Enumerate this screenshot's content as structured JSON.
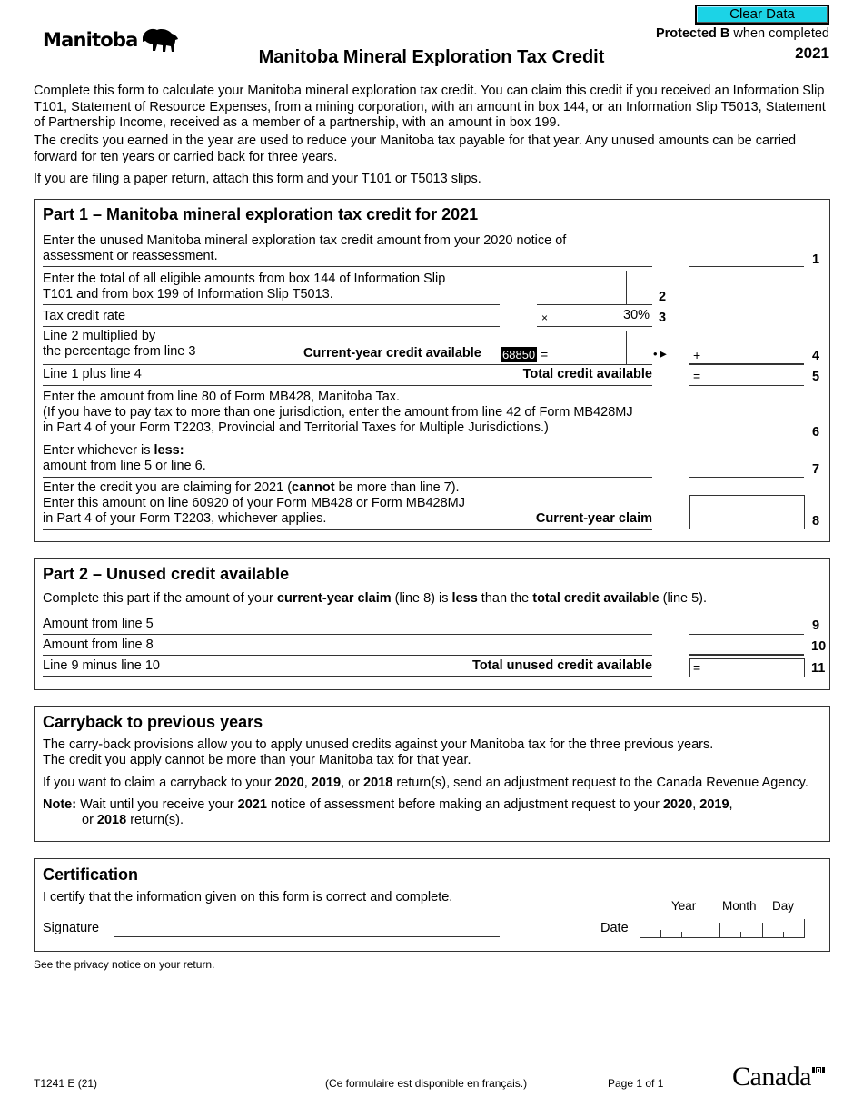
{
  "header": {
    "logo_text": "Manitoba",
    "clear_button": "Clear Data",
    "protected_bold": "Protected B",
    "protected_rest": " when completed",
    "year": "2021",
    "title": "Manitoba Mineral Exploration Tax Credit"
  },
  "intro": {
    "p1": "Complete this form to calculate your Manitoba mineral exploration tax credit. You can claim this credit if you received an Information Slip T101, Statement of Resource Expenses, from a mining corporation, with an amount in box 144, or an Information Slip T5013, Statement of Partnership Income, received as a member of a partnership, with an amount in box 199.",
    "p2": "The credits you earned in the year are used to reduce your Manitoba tax payable for that year. Any unused amounts can be carried forward for ten years or carried back for three years.",
    "p3": "If you are filing a paper return, attach this form and your T101 or T5013 slips."
  },
  "part1": {
    "title": "Part 1 – Manitoba mineral exploration tax credit for 2021",
    "line1_text": "Enter the unused Manitoba mineral exploration tax credit amount from your 2020 notice of assessment or reassessment.",
    "line1_num": "1",
    "line2_text": "Enter the total of all eligible amounts from box 144 of Information Slip T101 and from box 199 of Information Slip T5013.",
    "line2_num": "2",
    "line3_text": "Tax credit rate",
    "line3_symbol": "×",
    "line3_rate": "30%",
    "line3_num": "3",
    "line4_text_a": "Line 2 multiplied by",
    "line4_text_b": "the percentage from line 3",
    "line4_label": "Current-year credit available",
    "line4_code": "68850",
    "line4_eq": "=",
    "line4_arrow": "•►",
    "line4_symbol": "+",
    "line4_num": "4",
    "line5_text": "Line 1 plus line 4",
    "line5_label": "Total credit available",
    "line5_symbol": "=",
    "line5_num": "5",
    "line6_text_a": "Enter the amount from line 80 of Form MB428, Manitoba Tax.",
    "line6_text_b": "(If you have to pay tax to more than one jurisdiction, enter the amount from line 42 of Form MB428MJ",
    "line6_text_c": "in Part 4 of your Form T2203, Provincial and Territorial Taxes for Multiple Jurisdictions.)",
    "line6_num": "6",
    "line7_text_a_pre": "Enter whichever is ",
    "line7_text_a_bold": "less:",
    "line7_text_b": "amount from line 5 or line 6.",
    "line7_num": "7",
    "line8_text_a_pre": "Enter the credit you are claiming for 2021 (",
    "line8_text_a_bold": "cannot",
    "line8_text_a_post": " be more than line 7).",
    "line8_text_b": "Enter this amount on line 60920 of your Form MB428 or Form MB428MJ",
    "line8_text_c": "in Part 4 of your Form T2203, whichever applies.",
    "line8_label": "Current-year claim",
    "line8_num": "8"
  },
  "part2": {
    "title": "Part 2 – Unused credit available",
    "intro_a": "Complete this part if the amount of your ",
    "intro_b": "current-year claim",
    "intro_c": " (line 8) is ",
    "intro_d": "less",
    "intro_e": " than the ",
    "intro_f": "total credit available",
    "intro_g": " (line 5).",
    "line9_text": "Amount from line 5",
    "line9_num": "9",
    "line10_text": "Amount from line 8",
    "line10_symbol": "–",
    "line10_num": "10",
    "line11_text": "Line 9 minus line 10",
    "line11_label": "Total unused credit available",
    "line11_symbol": "=",
    "line11_num": "11"
  },
  "carryback": {
    "title": "Carryback to previous years",
    "p1a": "The carry-back provisions allow you to apply unused credits against your Manitoba tax for the three previous years.",
    "p1b": "The credit you apply cannot be more than your Manitoba tax for that year.",
    "p2_a": "If you want to claim a carryback to your ",
    "p2_y1": "2020",
    "p2_c1": ", ",
    "p2_y2": "2019",
    "p2_c2": ", or ",
    "p2_y3": "2018",
    "p2_rest": " return(s), send an adjustment request to the Canada Revenue Agency.",
    "note_label": "Note:",
    "note_a": " Wait until you receive your ",
    "note_y0": "2021",
    "note_b": " notice of assessment before making an adjustment request to your ",
    "note_y1": "2020",
    "note_c1": ", ",
    "note_y2": "2019",
    "note_c2": ",",
    "note_d": "or ",
    "note_y3": "2018",
    "note_e": " return(s)."
  },
  "certification": {
    "title": "Certification",
    "statement": "I certify that the information given on this form is correct and complete.",
    "signature_label": "Signature",
    "date_label": "Date",
    "year_label": "Year",
    "month_label": "Month",
    "day_label": "Day"
  },
  "privacy": "See the privacy notice on your return.",
  "footer": {
    "form_code": "T1241 E (21)",
    "french_notice": "(Ce formulaire est disponible en français.)",
    "page": "Page 1 of 1",
    "canada_wordmark": "Canada"
  },
  "colors": {
    "clear_button_bg": "#1cd3e6"
  }
}
